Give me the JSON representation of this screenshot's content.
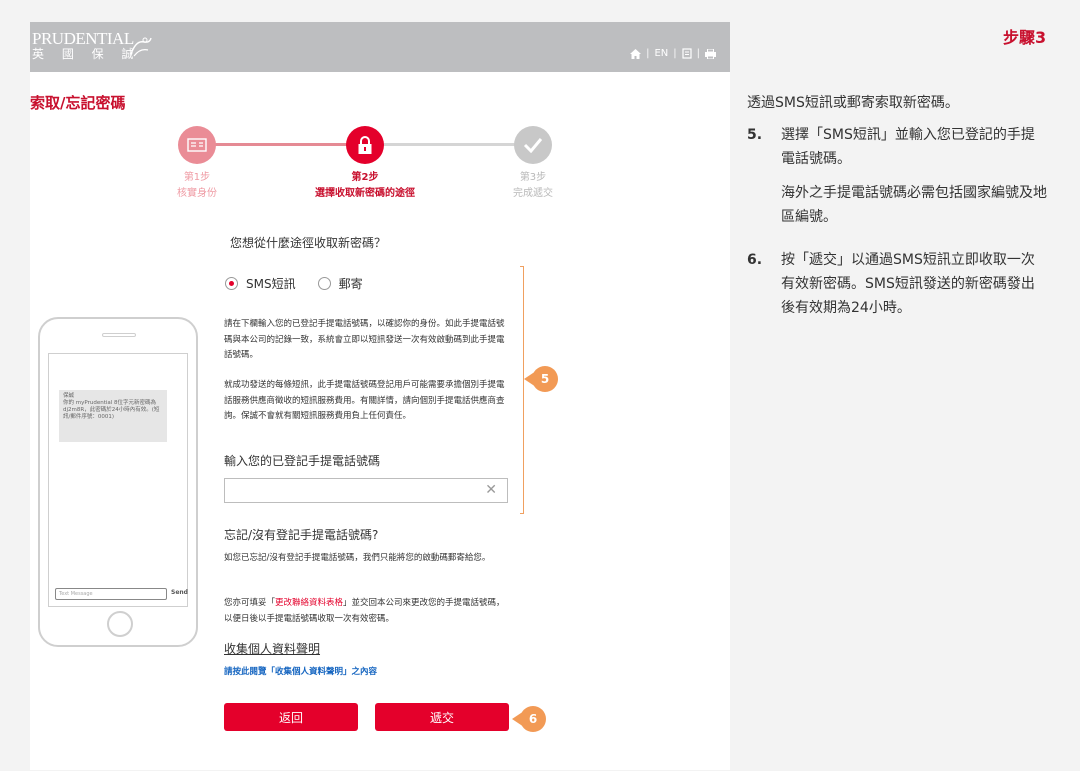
{
  "header": {
    "logo_en": "PRUDENTIAL",
    "logo_zh": "英 國 保 誠",
    "lang": "EN"
  },
  "page_title": "索取/忘記密碼",
  "steps": [
    {
      "num": "第1步",
      "label": "核實身份"
    },
    {
      "num": "第2步",
      "label": "選擇收取新密碼的途徑"
    },
    {
      "num": "第3步",
      "label": "完成遞交"
    }
  ],
  "question": "您想從什麼途徑收取新密碼？",
  "options": {
    "sms": "SMS短訊",
    "mail": "郵寄",
    "selected": "sms"
  },
  "para1": "請在下欄輸入您的已登記手提電話號碼，以確認你的身份。如此手提電話號碼與本公司的記錄一致，系統會立即以短訊發送一次有效啟動碼到此手提電話號碼。",
  "para2": "就成功發送的每條短訊，此手提電話號碼登記用戶可能需要承擔個別手提電話服務供應商徵收的短訊服務費用。有關詳情，請向個別手提電話供應商查詢。保誠不會就有關短訊服務費用負上任何責任。",
  "phone_label": "輸入您的已登記手提電話號碼",
  "phone_value": "",
  "forgot_title": "忘記/沒有登記手提電話號碼?",
  "para3": "如您已忘記/沒有登記手提電話號碼，我們只能將您的啟動碼郵寄給您。",
  "para4_pre": "您亦可填妥「",
  "para4_link": "更改聯絡資料表格",
  "para4_post": "」並交回本公司來更改您的手提電話號碼，以便日後以手提電話號碼收取一次有效密碼。",
  "pics_title": "收集個人資料聲明",
  "pics_link": "請按此閱覽「收集個人資料聲明」之內容",
  "buttons": {
    "back": "返回",
    "submit": "遞交"
  },
  "callouts": {
    "c5": "5",
    "c6": "6"
  },
  "phone_mock": {
    "sms_text": "保誠\n你的 myPrudential 8位字元新密碼為 dj2m8R，此密碼於24小時內有效。(短訊/郵件序號：0001)",
    "input_placeholder": "Text Message",
    "send": "Send"
  },
  "side": {
    "title": "步驟3",
    "intro": "透過SMS短訊或郵寄索取新密碼。",
    "items": [
      {
        "n": "5.",
        "t": "選擇「SMS短訊」並輸入您已登記的手提電話號碼。"
      },
      {
        "n": "",
        "t": "海外之手提電話號碼必需包括國家編號及地區編號。"
      },
      {
        "n": "6.",
        "t": "按「遞交」以通過SMS短訊立即收取一次有效新密碼。SMS短訊發送的新密碼發出後有效期為24小時。"
      }
    ]
  },
  "colors": {
    "brand_red": "#e4002b",
    "callout_orange": "#f29a55",
    "header_gray": "#bdbec0"
  }
}
